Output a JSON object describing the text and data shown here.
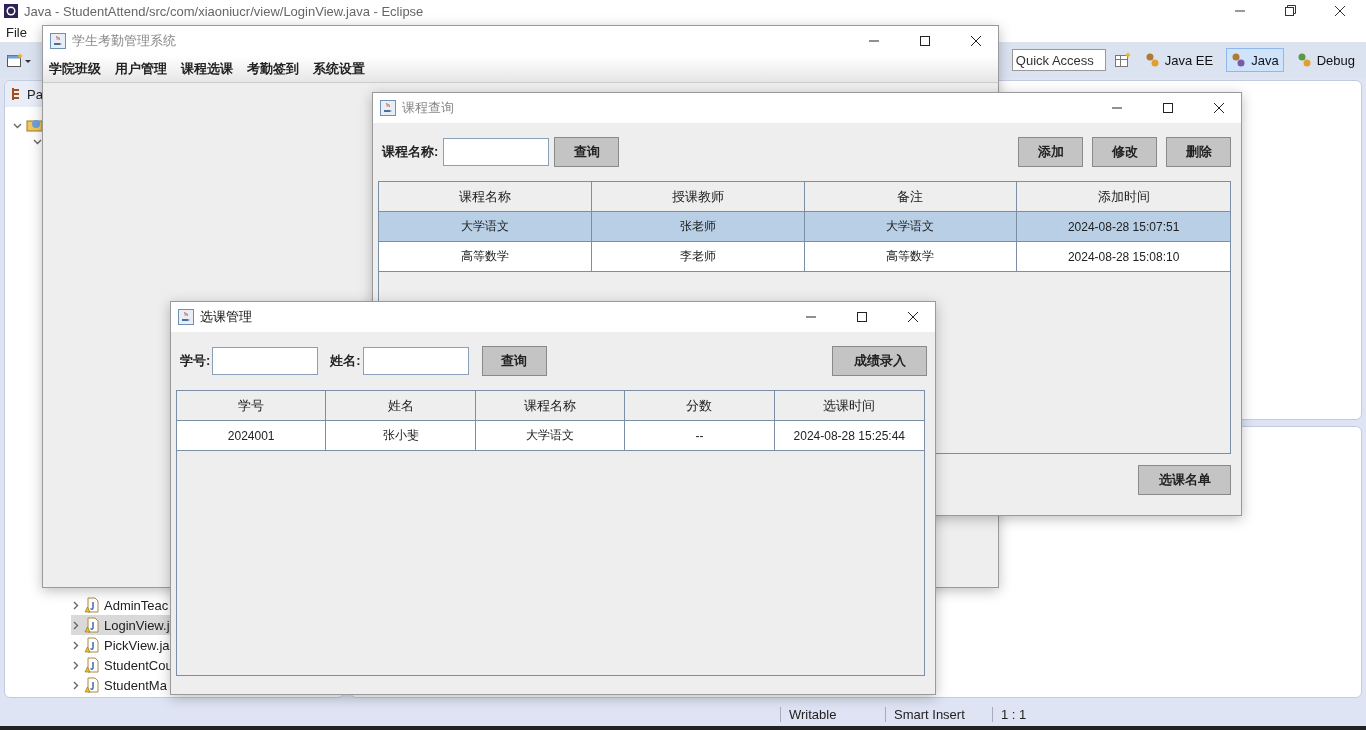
{
  "eclipse": {
    "title": "Java - StudentAttend/src/com/xiaoniucr/view/LoginView.java - Eclipse",
    "menu": [
      "File"
    ],
    "quick_access": {
      "placeholder": "Quick Access"
    },
    "perspectives": [
      {
        "label": "Java EE",
        "selected": false
      },
      {
        "label": "Java",
        "selected": true
      },
      {
        "label": "Debug",
        "selected": false
      }
    ],
    "explorer": {
      "tab": "Pa",
      "files": [
        {
          "name": "AdminTeac",
          "selected": false
        },
        {
          "name": "LoginView.j",
          "selected": true
        },
        {
          "name": "PickView.ja",
          "selected": false
        },
        {
          "name": "StudentCou",
          "selected": false
        },
        {
          "name": "StudentMa",
          "selected": false
        }
      ]
    },
    "status_bar": [
      "Writable",
      "Smart Insert",
      "1 : 1"
    ]
  },
  "main_window": {
    "title": "学生考勤管理系统",
    "menu": [
      "学院班级",
      "用户管理",
      "课程选课",
      "考勤签到",
      "系统设置"
    ]
  },
  "course_window": {
    "title": "课程查询",
    "search_label": "课程名称:",
    "search_button": "查询",
    "actions": [
      "添加",
      "修改",
      "删除"
    ],
    "table": {
      "columns": [
        "课程名称",
        "授课教师",
        "备注",
        "添加时间"
      ],
      "rows": [
        {
          "cells": [
            "大学语文",
            "张老师",
            "大学语文",
            "2024-08-28 15:07:51"
          ],
          "selected": true
        },
        {
          "cells": [
            "高等数学",
            "李老师",
            "高等数学",
            "2024-08-28 15:08:10"
          ],
          "selected": false
        }
      ]
    },
    "footer_button": "选课名单"
  },
  "pick_window": {
    "title": "选课管理",
    "fields": [
      {
        "label": "学号:"
      },
      {
        "label": "姓名:"
      }
    ],
    "search_button": "查询",
    "action_button": "成绩录入",
    "table": {
      "columns": [
        "学号",
        "姓名",
        "课程名称",
        "分数",
        "选课时间"
      ],
      "rows": [
        {
          "cells": [
            "2024001",
            "张小斐",
            "大学语文",
            "--",
            "2024-08-28 15:25:44"
          ],
          "selected": false
        }
      ]
    }
  }
}
